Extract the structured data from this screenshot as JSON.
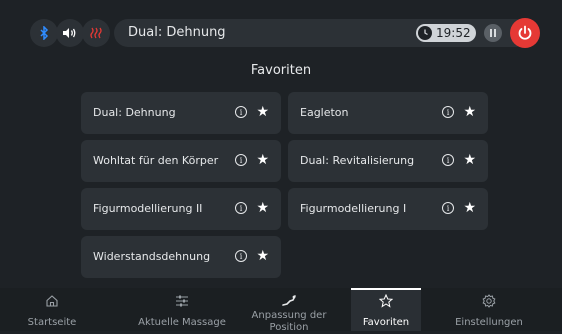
{
  "header": {
    "current_program": "Dual: Dehnung",
    "timer": "19:52",
    "icons": [
      "bluetooth-icon",
      "volume-icon",
      "heat-icon",
      "clock-icon",
      "pause-icon",
      "power-icon"
    ],
    "colors": {
      "bluetooth": "#2f8cff",
      "heat": "#e53935",
      "power": "#e53935"
    }
  },
  "favorites": {
    "title": "Favoriten",
    "items": [
      {
        "label": "Dual: Dehnung"
      },
      {
        "label": "Eagleton"
      },
      {
        "label": "Wohltat für den Körper"
      },
      {
        "label": "Dual: Revitalisierung"
      },
      {
        "label": "Figurmodellierung II"
      },
      {
        "label": "Figurmodellierung I"
      },
      {
        "label": "Widerstandsdehnung"
      }
    ],
    "info_glyph": "i",
    "star_glyph": "★"
  },
  "nav": {
    "tabs": [
      {
        "label": "Startseite",
        "icon": "home-icon"
      },
      {
        "label": "Aktuelle Massage",
        "icon": "sliders-icon"
      },
      {
        "label": "Anpassung der Position",
        "icon": "position-icon"
      },
      {
        "label": "Favoriten",
        "icon": "star-icon",
        "active": true
      },
      {
        "label": "Einstellungen",
        "icon": "gear-icon"
      }
    ]
  }
}
